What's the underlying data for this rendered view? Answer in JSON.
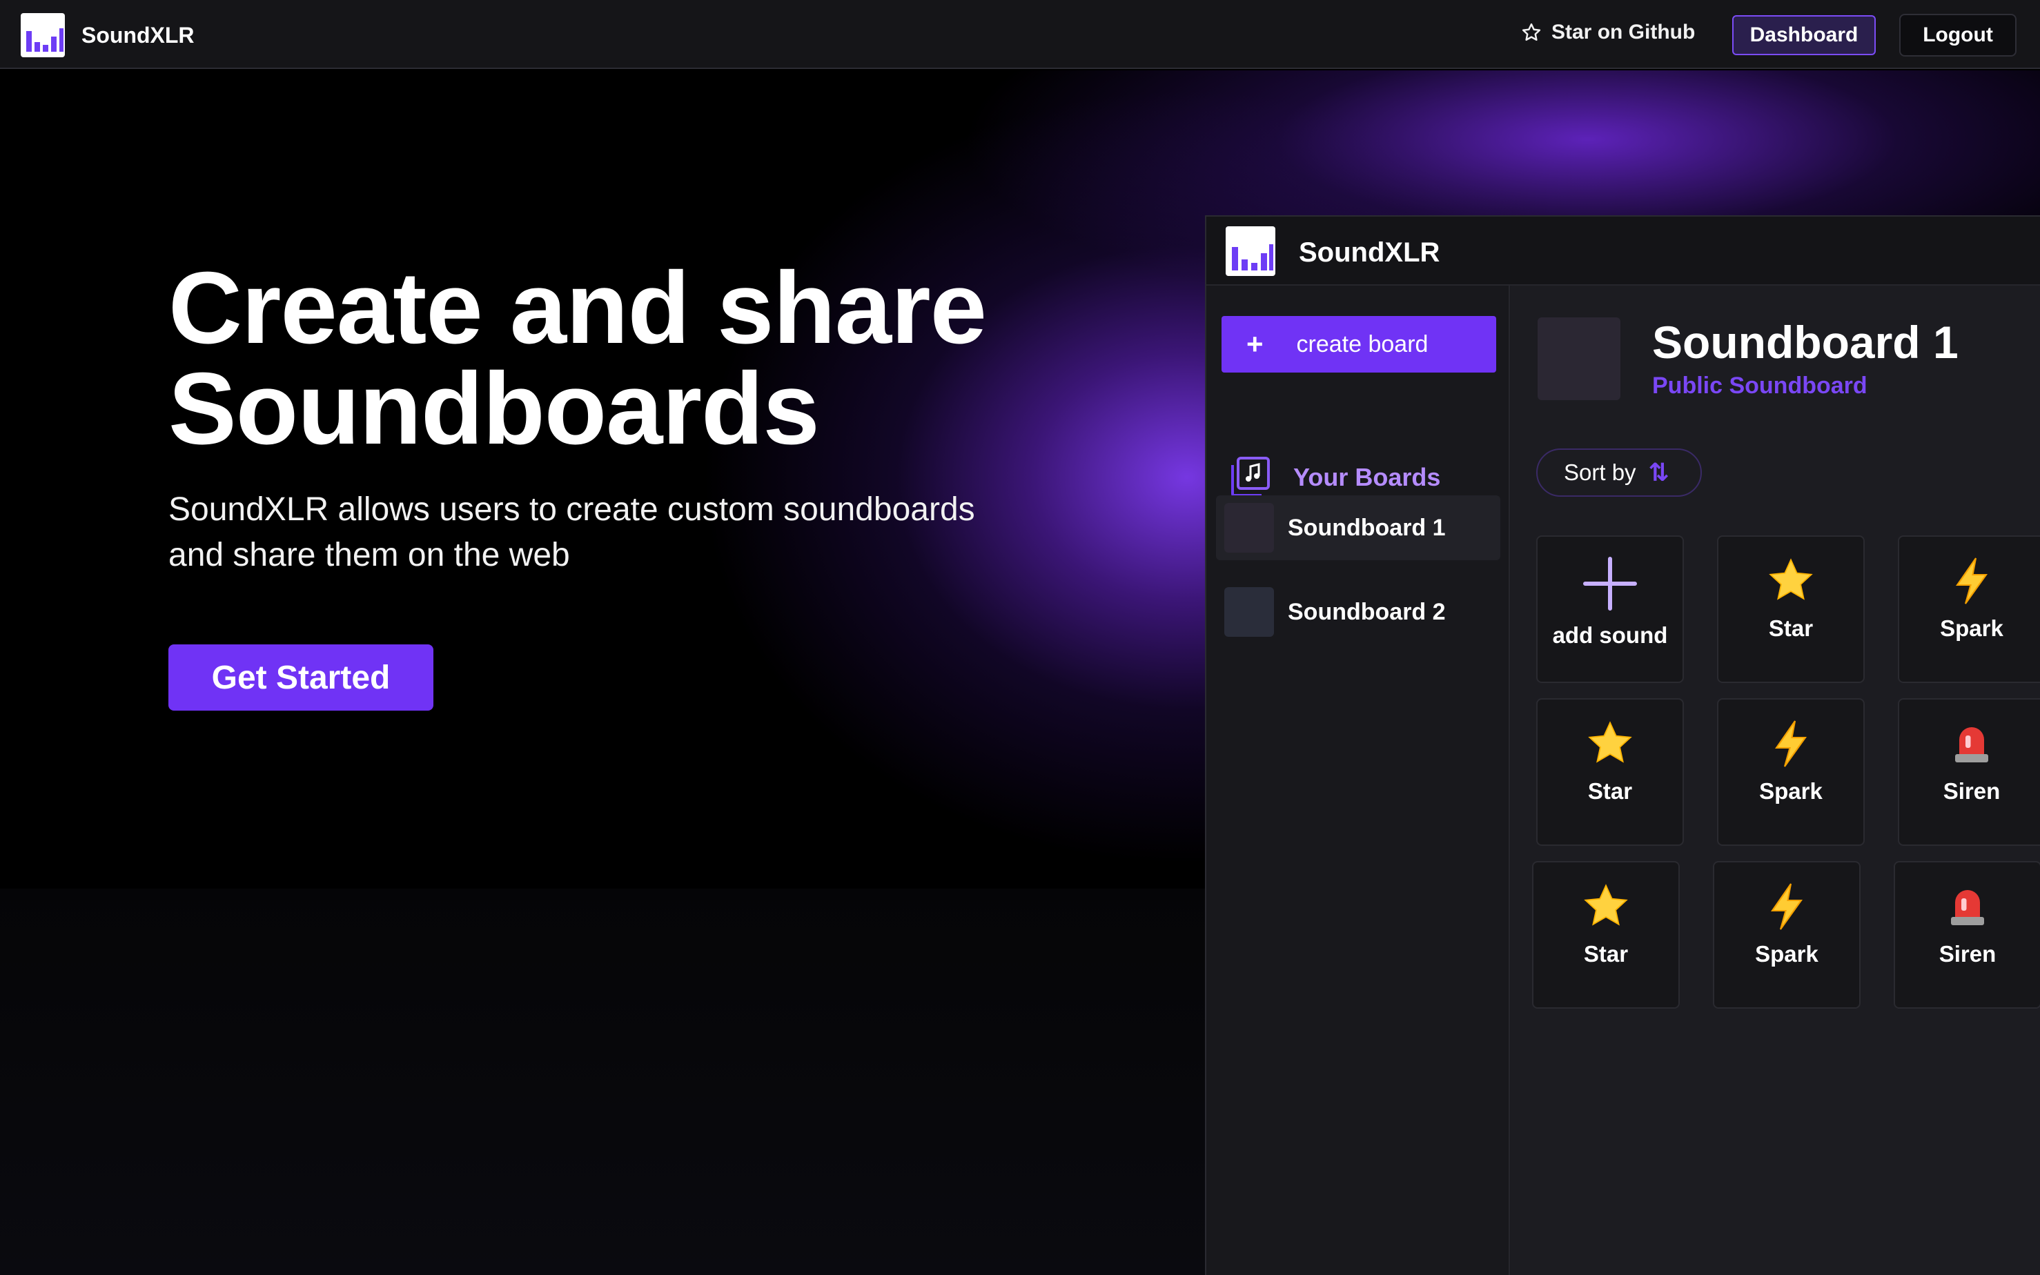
{
  "nav": {
    "brand": "SoundXLR",
    "github_label": "Star on Github",
    "dashboard_label": "Dashboard",
    "logout_label": "Logout"
  },
  "hero": {
    "headline_line1": "Create and share",
    "headline_line2": "Soundboards",
    "subline_line1": "SoundXLR allows users to create custom soundboards",
    "subline_line2": "and share them on the web",
    "cta_label": "Get Started"
  },
  "preview": {
    "app_title": "SoundXLR",
    "create_board_label": "create board",
    "your_boards_label": "Your Boards",
    "boards": [
      {
        "name": "Soundboard 1",
        "active": true
      },
      {
        "name": "Soundboard 2",
        "active": false
      }
    ],
    "board_title": "Soundboard 1",
    "board_subtitle": "Public Soundboard",
    "sort_label": "Sort by",
    "add_sound_label": "add sound",
    "sounds": [
      {
        "label": "Star",
        "icon": "star-emoji-icon"
      },
      {
        "label": "Spark",
        "icon": "lightning-emoji-icon"
      },
      {
        "label": "Star",
        "icon": "star-emoji-icon"
      },
      {
        "label": "Spark",
        "icon": "lightning-emoji-icon"
      },
      {
        "label": "Siren",
        "icon": "siren-emoji-icon"
      },
      {
        "label": "Star",
        "icon": "star-emoji-icon"
      },
      {
        "label": "Spark",
        "icon": "lightning-emoji-icon"
      },
      {
        "label": "Siren",
        "icon": "siren-emoji-icon"
      }
    ]
  },
  "colors": {
    "accent": "#7033f5",
    "accent_text": "#b58cff",
    "nav_bg": "#151518",
    "panel_bg": "#1b1b20"
  }
}
